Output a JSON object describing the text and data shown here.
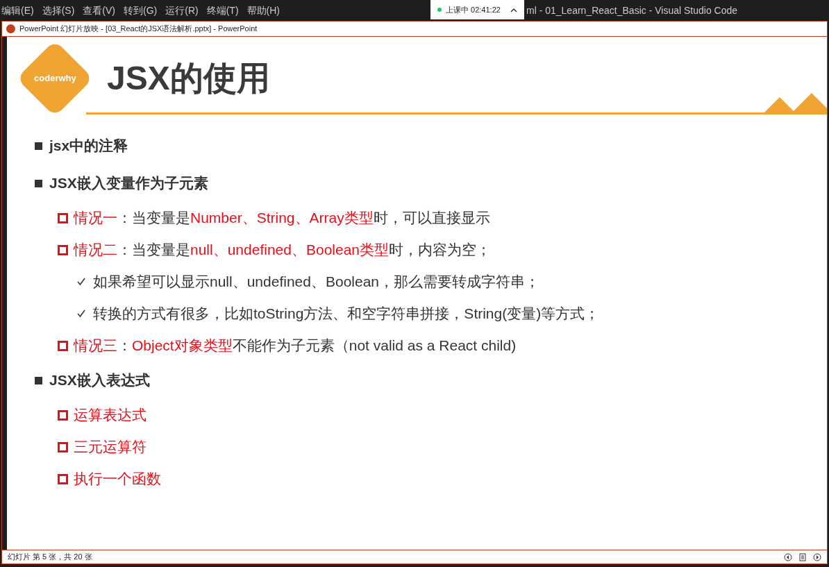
{
  "editor_menu": [
    "编辑(E)",
    "选择(S)",
    "查看(V)",
    "转到(G)",
    "运行(R)",
    "终端(T)",
    "帮助(H)"
  ],
  "recording": {
    "label": "上课中 02:41:22",
    "expanded": false
  },
  "editor_title": "ml - 01_Learn_React_Basic - Visual Studio Code",
  "presentation_window": {
    "title": "PowerPoint 幻灯片放映 - [03_React的JSX语法解析.pptx] - PowerPoint"
  },
  "slide": {
    "logo": "coderwhy",
    "title": "JSX的使用",
    "items": [
      {
        "kind": "square",
        "parts": [
          {
            "text": "jsx中的注释",
            "red": false
          }
        ]
      },
      {
        "kind": "square",
        "parts": [
          {
            "text": "JSX嵌入变量作为子元素",
            "red": false
          }
        ],
        "children": [
          {
            "kind": "hollow",
            "parts": [
              {
                "text": "情况一",
                "red": true
              },
              {
                "text": "：当变量是",
                "red": false
              },
              {
                "text": "Number、String、Array类型",
                "red": true
              },
              {
                "text": "时，可以直接显示",
                "red": false
              }
            ]
          },
          {
            "kind": "hollow",
            "parts": [
              {
                "text": "情况二",
                "red": true
              },
              {
                "text": "：当变量是",
                "red": false
              },
              {
                "text": "null、undefined、Boolean类型",
                "red": true
              },
              {
                "text": "时，内容为空；",
                "red": false
              }
            ],
            "children": [
              {
                "kind": "check",
                "parts": [
                  {
                    "text": "如果希望可以显示null、undefined、Boolean，那么需要转成字符串；",
                    "red": false
                  }
                ]
              },
              {
                "kind": "check",
                "parts": [
                  {
                    "text": "转换的方式有很多，比如toString方法、和空字符串拼接，String(变量)等方式；",
                    "red": false
                  }
                ]
              }
            ]
          },
          {
            "kind": "hollow",
            "parts": [
              {
                "text": "情况三",
                "red": true
              },
              {
                "text": "：",
                "red": false
              },
              {
                "text": "Object对象类型",
                "red": true
              },
              {
                "text": "不能作为子元素（not valid as a React child)",
                "red": false
              }
            ]
          }
        ]
      },
      {
        "kind": "square",
        "parts": [
          {
            "text": "JSX嵌入表达式",
            "red": false
          }
        ],
        "children": [
          {
            "kind": "hollow",
            "parts": [
              {
                "text": "运算表达式",
                "red": true
              }
            ]
          },
          {
            "kind": "hollow",
            "parts": [
              {
                "text": "三元运算符",
                "red": true
              }
            ]
          },
          {
            "kind": "hollow",
            "parts": [
              {
                "text": "执行一个函数",
                "red": true
              }
            ]
          }
        ]
      }
    ]
  },
  "status_bar": {
    "slide_counter": "幻灯片 第 5 张，共 20 张"
  }
}
